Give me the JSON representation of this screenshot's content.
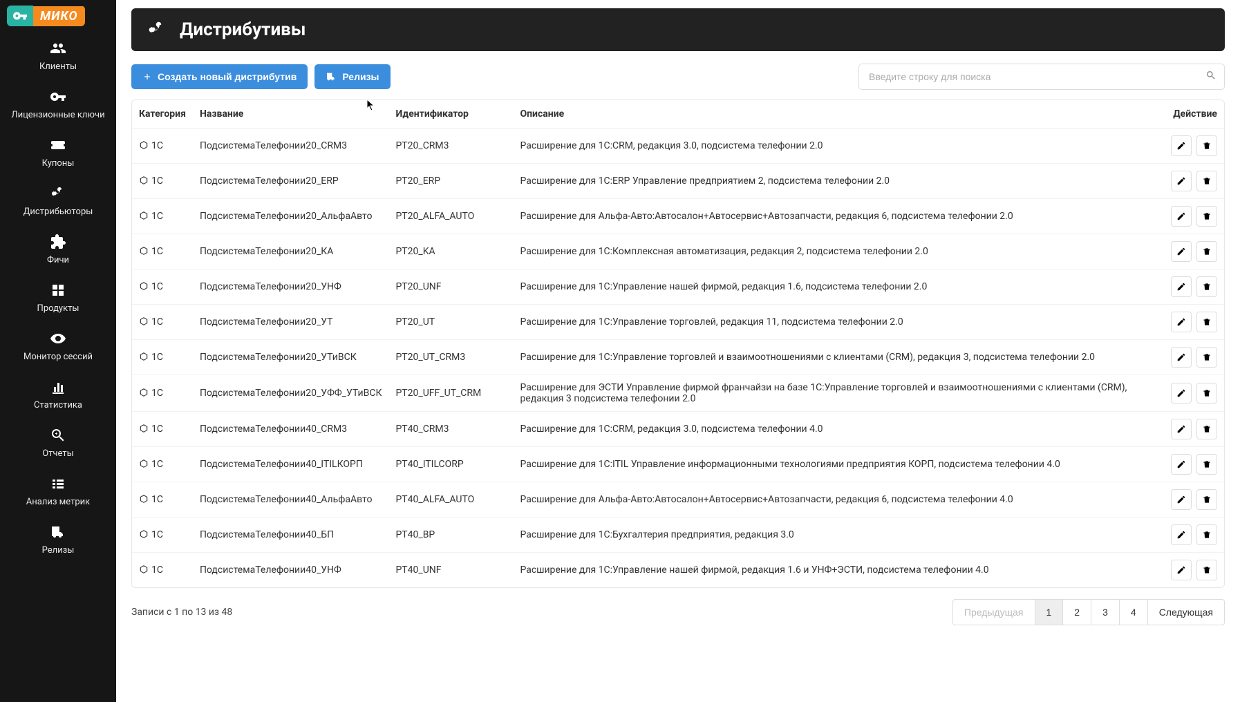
{
  "logo": {
    "brand": "МИКО"
  },
  "sidebar": {
    "items": [
      {
        "label": "Клиенты",
        "icon": "users"
      },
      {
        "label": "Лицензионные ключи",
        "icon": "key"
      },
      {
        "label": "Купоны",
        "icon": "ticket"
      },
      {
        "label": "Дистрибьюторы",
        "icon": "branch"
      },
      {
        "label": "Фичи",
        "icon": "puzzle"
      },
      {
        "label": "Продукты",
        "icon": "grid"
      },
      {
        "label": "Монитор сессий",
        "icon": "eye"
      },
      {
        "label": "Статистика",
        "icon": "chart"
      },
      {
        "label": "Отчеты",
        "icon": "zoom"
      },
      {
        "label": "Анализ метрик",
        "icon": "list"
      },
      {
        "label": "Релизы",
        "icon": "truck"
      }
    ]
  },
  "page": {
    "title": "Дистрибутивы"
  },
  "toolbar": {
    "create_label": "Создать новый дистрибутив",
    "releases_label": "Релизы"
  },
  "search": {
    "placeholder": "Введите строку для поиска"
  },
  "table": {
    "headers": {
      "category": "Категория",
      "name": "Название",
      "identifier": "Идентификатор",
      "description": "Описание",
      "action": "Действие"
    },
    "rows": [
      {
        "category": "1С",
        "name": "ПодсистемаТелефонии20_CRM3",
        "identifier": "PT20_CRM3",
        "description": "Расширение для 1С:CRM, редакция 3.0, подсистема телефонии 2.0"
      },
      {
        "category": "1С",
        "name": "ПодсистемаТелефонии20_ERP",
        "identifier": "PT20_ERP",
        "description": "Расширение для 1С:ERP Управление предприятием 2, подсистема телефонии 2.0"
      },
      {
        "category": "1С",
        "name": "ПодсистемаТелефонии20_АльфаАвто",
        "identifier": "PT20_ALFA_AUTO",
        "description": "Расширение для Альфа-Авто:Автосалон+Автосервис+Автозапчасти, редакция 6, подсистема телефонии 2.0"
      },
      {
        "category": "1С",
        "name": "ПодсистемаТелефонии20_КА",
        "identifier": "PT20_KA",
        "description": "Расширение для 1С:Комплексная автоматизация, редакция 2, подсистема телефонии 2.0"
      },
      {
        "category": "1С",
        "name": "ПодсистемаТелефонии20_УНФ",
        "identifier": "PT20_UNF",
        "description": "Расширение для 1С:Управление нашей фирмой, редакция 1.6, подсистема телефонии 2.0"
      },
      {
        "category": "1С",
        "name": "ПодсистемаТелефонии20_УТ",
        "identifier": "PT20_UT",
        "description": "Расширение для 1С:Управление торговлей, редакция 11, подсистема телефонии 2.0"
      },
      {
        "category": "1С",
        "name": "ПодсистемаТелефонии20_УТиВСК",
        "identifier": "PT20_UT_CRM3",
        "description": "Расширение для 1С:Управление торговлей и взаимоотношениями с клиентами (CRM), редакция 3, подсистема телефонии 2.0"
      },
      {
        "category": "1С",
        "name": "ПодсистемаТелефонии20_УФФ_УТиВСК",
        "identifier": "PT20_UFF_UT_CRM",
        "description": "Расширение для ЭСТИ Управление фирмой франчайзи на базе 1С:Управление торговлей и взаимоотношениями с клиентами (CRM), редакция 3 подсистема телефонии 2.0"
      },
      {
        "category": "1С",
        "name": "ПодсистемаТелефонии40_CRM3",
        "identifier": "PT40_CRM3",
        "description": "Расширение для 1С:CRM, редакция 3.0, подсистема телефонии 4.0"
      },
      {
        "category": "1С",
        "name": "ПодсистемаТелефонии40_ITILКОРП",
        "identifier": "PT40_ITILCORP",
        "description": "Расширение для 1С:ITIL Управление информационными технологиями предприятия КОРП, подсистема телефонии 4.0"
      },
      {
        "category": "1С",
        "name": "ПодсистемаТелефонии40_АльфаАвто",
        "identifier": "PT40_ALFA_AUTO",
        "description": "Расширение для Альфа-Авто:Автосалон+Автосервис+Автозапчасти, редакция 6, подсистема телефонии 4.0"
      },
      {
        "category": "1С",
        "name": "ПодсистемаТелефонии40_БП",
        "identifier": "PT40_BP",
        "description": "Расширение для 1С:Бухгалтерия предприятия, редакция 3.0"
      },
      {
        "category": "1С",
        "name": "ПодсистемаТелефонии40_УНФ",
        "identifier": "PT40_UNF",
        "description": "Расширение для 1С:Управление нашей фирмой, редакция 1.6 и УНФ+ЭСТИ, подсистема телефонии 4.0"
      }
    ]
  },
  "pagination": {
    "info": "Записи с 1 по 13 из 48",
    "prev": "Предыдущая",
    "next": "Следующая",
    "pages": [
      "1",
      "2",
      "3",
      "4"
    ],
    "active": "1"
  }
}
